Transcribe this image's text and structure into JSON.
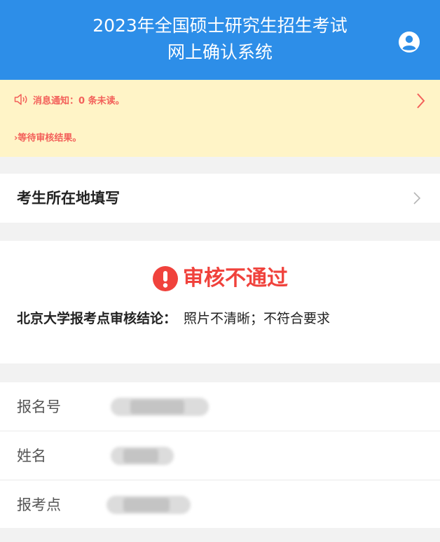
{
  "header": {
    "title_line1": "2023年全国硕士研究生招生考试",
    "title_line2": "网上确认系统",
    "bg_color": "#2d8ee8",
    "user_icon": "user-circle-icon"
  },
  "notice": {
    "message": "消息通知：0 条未读。",
    "status_text": "›等待审核结果。",
    "speaker_icon": "speaker-icon",
    "color": "#f3605a",
    "bg_color": "#fff4c7"
  },
  "location_card": {
    "label": "考生所在地填写"
  },
  "review": {
    "status": "审核不通过",
    "status_color": "#f0423c",
    "conclusion_label": "北京大学报考点审核结论：",
    "conclusion_value": "照片不清晰；不符合要求"
  },
  "info": {
    "rows": [
      {
        "label": "报名号"
      },
      {
        "label": "姓名"
      },
      {
        "label": "报考点"
      }
    ]
  }
}
